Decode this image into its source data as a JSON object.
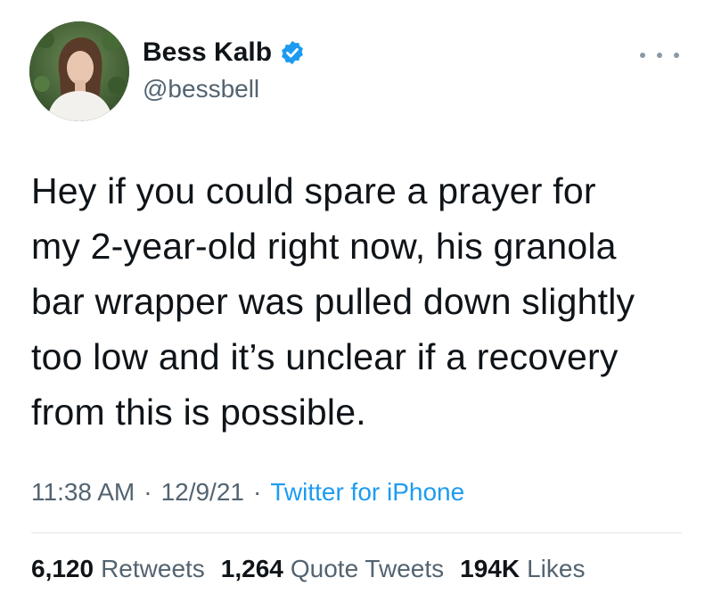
{
  "author": {
    "display_name": "Bess Kalb",
    "handle": "@bessbell",
    "verified": true,
    "avatar_icon": "profile-photo"
  },
  "tweet": {
    "text_lines": [
      "Hey if you could spare a prayer for",
      "my 2-year-old right now, his granola",
      "bar wrapper was pulled down slightly",
      "too low and it’s unclear if a recovery",
      "from this is possible."
    ],
    "time": "11:38 AM",
    "date": "12/9/21",
    "separator": "·",
    "source": "Twitter for iPhone"
  },
  "stats": {
    "retweets_count": "6,120",
    "retweets_label": "Retweets",
    "quotes_count": "1,264",
    "quotes_label": "Quote Tweets",
    "likes_count": "194K",
    "likes_label": "Likes"
  },
  "colors": {
    "text": "#0f1419",
    "secondary": "#536471",
    "accent": "#1d9bf0",
    "divider": "#e1e8ed"
  }
}
